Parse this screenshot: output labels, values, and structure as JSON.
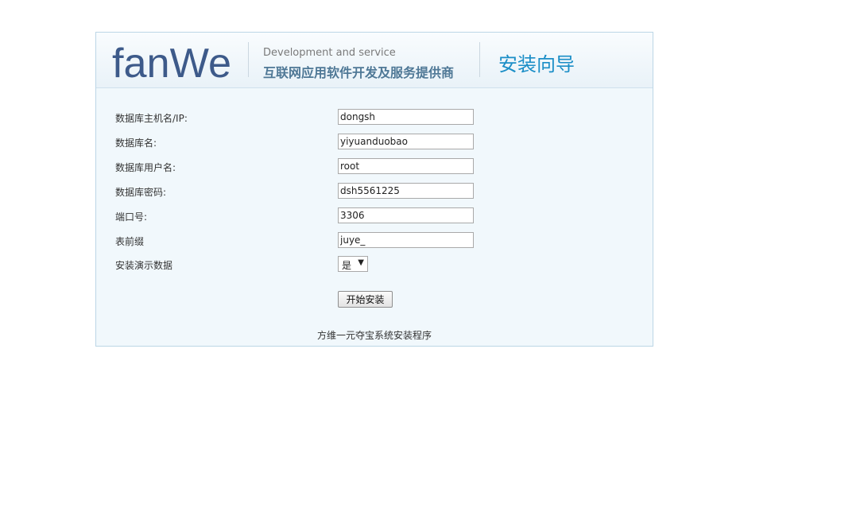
{
  "header": {
    "logo_text": "fanWe",
    "tagline_en": "Development and service",
    "tagline_cn": "互联网应用软件开发及服务提供商",
    "title": "安装向导"
  },
  "form": {
    "db_host": {
      "label": "数据库主机名/IP:",
      "value": "dongsh"
    },
    "db_name": {
      "label": "数据库名:",
      "value": "yiyuanduobao"
    },
    "db_user": {
      "label": "数据库用户名:",
      "value": "root"
    },
    "db_password": {
      "label": "数据库密码:",
      "value": "dsh5561225"
    },
    "port": {
      "label": "端口号:",
      "value": "3306"
    },
    "table_prefix": {
      "label": "表前缀",
      "value": "juye_"
    },
    "demo_data": {
      "label": "安装演示数据",
      "selected": "是"
    },
    "submit_label": "开始安装"
  },
  "footer": {
    "text": "方维一元夺宝系统安装程序"
  },
  "colors": {
    "brand": "#3d5a8a",
    "title_blue": "#1b8ec7",
    "panel_bg": "#f1f8fc",
    "panel_border": "#bcd6e6"
  },
  "icons": {
    "select_arrow": "triangle-down-icon"
  }
}
